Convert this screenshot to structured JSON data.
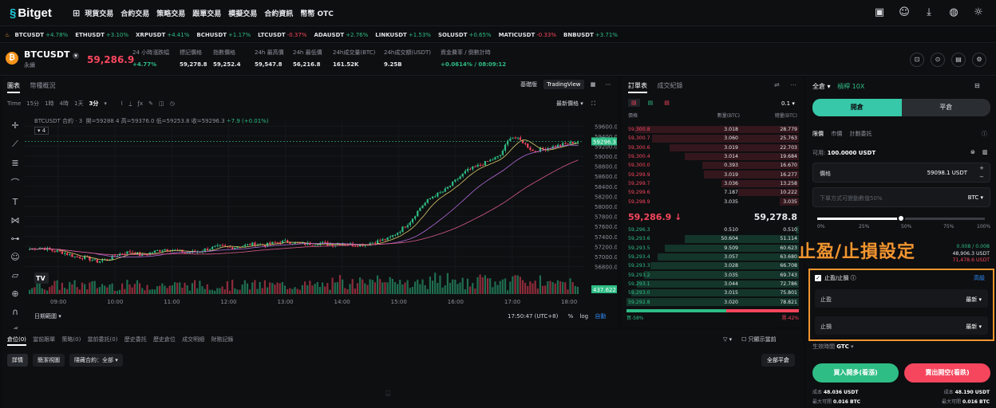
{
  "brand": {
    "name": "Bitget"
  },
  "nav": [
    "現貨交易",
    "合約交易",
    "策略交易",
    "跟單交易",
    "模擬交易",
    "合約資訊",
    "幣幣 OTC"
  ],
  "ticker": [
    {
      "sym": "BTCUSDT",
      "chg": "+4.78%",
      "dir": "up"
    },
    {
      "sym": "ETHUSDT",
      "chg": "+3.10%",
      "dir": "up"
    },
    {
      "sym": "XRPUSDT",
      "chg": "+4.41%",
      "dir": "up"
    },
    {
      "sym": "BCHUSDT",
      "chg": "+1.17%",
      "dir": "up"
    },
    {
      "sym": "LTCUSDT",
      "chg": "-0.37%",
      "dir": "dn"
    },
    {
      "sym": "ADAUSDT",
      "chg": "+2.76%",
      "dir": "up"
    },
    {
      "sym": "LINKUSDT",
      "chg": "+1.53%",
      "dir": "up"
    },
    {
      "sym": "SOLUSDT",
      "chg": "+0.65%",
      "dir": "up"
    },
    {
      "sym": "MATICUSDT",
      "chg": "-0.33%",
      "dir": "dn"
    },
    {
      "sym": "BNBUSDT",
      "chg": "+3.71%",
      "dir": "up"
    }
  ],
  "symbol": {
    "name": "BTCUSDT",
    "sub": "永續",
    "price": "59,286.9",
    "stats": [
      {
        "label": "24 小時漲跌幅",
        "value": "+4.77%",
        "cls": "up"
      },
      {
        "label": "標記價格",
        "value": "59,278.8",
        "cls": ""
      },
      {
        "label": "指數價格",
        "value": "59,252.4",
        "cls": ""
      },
      {
        "label": "24h 最高價",
        "value": "59,547.8",
        "cls": ""
      },
      {
        "label": "24h 最低價",
        "value": "56,216.8",
        "cls": ""
      },
      {
        "label": "24h成交量(BTC)",
        "value": "161.52K",
        "cls": ""
      },
      {
        "label": "24h成交額(USDT)",
        "value": "9.25B",
        "cls": ""
      },
      {
        "label": "資金費率 / 倒數計時",
        "value": "+0.0614% / 08:09:12",
        "cls": "up"
      }
    ]
  },
  "chart": {
    "tabs": [
      "圖表",
      "幣種概況"
    ],
    "views": [
      "基礎版",
      "TradingView"
    ],
    "timeframes": [
      "Time",
      "15分",
      "1時",
      "4時",
      "1天",
      "3分"
    ],
    "selected_tf": "3分",
    "latest_label": "最新價格",
    "ohlc_sym": "BTCUSDT 合約 · 3",
    "ohlc": "開=59288.4 高=59376.0 低=59253.8 收=59296.3",
    "ohlc_chg": "+7.9 (+0.01%)",
    "indicator": "4",
    "date_range": "日期範圍",
    "clock": "17:50:47 (UTC+8)",
    "pct": "%",
    "log": "log",
    "auto": "自動"
  },
  "chart_data": {
    "type": "candlestick",
    "x": [
      "09:00",
      "10:00",
      "11:00",
      "12:00",
      "13:00",
      "14:00",
      "15:00",
      "16:00",
      "17:00",
      "18:00"
    ],
    "y_ticks": [
      59600,
      59400,
      59200,
      59000,
      58800,
      58600,
      58400,
      58200,
      58000,
      57800,
      57600,
      57400,
      57200,
      57000,
      56800
    ],
    "ylim": [
      56650,
      59700
    ],
    "last_price": 59296.3,
    "volume_label": "437.622",
    "close_path": [
      57150,
      57180,
      57120,
      57080,
      57000,
      56980,
      56900,
      56950,
      57050,
      57100,
      57020,
      57090,
      57150,
      57120,
      57080,
      57100,
      57160,
      57200,
      57180,
      57210,
      57250,
      57230,
      57280,
      57300,
      57260,
      57250,
      57270,
      57240,
      57260,
      57230,
      57250,
      57300,
      57350,
      57500,
      57700,
      58000,
      58200,
      58300,
      58500,
      58700,
      58800,
      58900,
      59000,
      59400,
      59300,
      59100,
      59150,
      59200,
      59250,
      59296
    ]
  },
  "orderbook": {
    "tabs": [
      "訂單表",
      "成交紀錄"
    ],
    "precision": "0.1",
    "headers": [
      "價格",
      "數量(BTC)",
      "總量(BTC)"
    ],
    "asks": [
      [
        "59,300.8",
        "3.018",
        "28.779",
        0.95
      ],
      [
        "59,300.7",
        "3.060",
        "25.763",
        0.85
      ],
      [
        "59,300.6",
        "3.019",
        "22.703",
        0.75
      ],
      [
        "59,300.4",
        "3.014",
        "19.684",
        0.66
      ],
      [
        "59,300.0",
        "0.393",
        "16.670",
        0.56
      ],
      [
        "59,299.9",
        "3.019",
        "16.277",
        0.55
      ],
      [
        "59,299.7",
        "3.036",
        "13.258",
        0.45
      ],
      [
        "59,299.6",
        "7.187",
        "10.222",
        0.35
      ],
      [
        "59,298.9",
        "3.035",
        "3.035",
        0.11
      ]
    ],
    "mid_price": "59,286.9",
    "mid_arrow": "↓",
    "mark": "59,278.8",
    "bids": [
      [
        "59,296.3",
        "0.510",
        "0.510",
        0.02
      ],
      [
        "59,293.6",
        "50.604",
        "51.114",
        0.66
      ],
      [
        "59,293.5",
        "9.509",
        "60.623",
        0.78
      ],
      [
        "59,293.4",
        "3.057",
        "63.680",
        0.82
      ],
      [
        "59,293.3",
        "3.028",
        "66.708",
        0.86
      ],
      [
        "59,293.2",
        "3.035",
        "69.743",
        0.9
      ],
      [
        "59,293.1",
        "3.044",
        "72.786",
        0.94
      ],
      [
        "59,293.0",
        "3.015",
        "75.801",
        0.97
      ],
      [
        "59,292.8",
        "3.020",
        "78.821",
        1.0
      ]
    ],
    "buy_pct": "買-58%",
    "sell_pct": "賣-42%"
  },
  "trade": {
    "margin_mode": "全倉",
    "leverage": "槓桿 10X",
    "open": "開倉",
    "close": "平倉",
    "order_types": [
      "限價",
      "市價",
      "計劃委託"
    ],
    "avail_label": "可用:",
    "avail_value": "100.0000 USDT",
    "price_label": "價格",
    "price_value": "59098.1 USDT",
    "qty_placeholder": "下單方式可變動數值50%",
    "qty_unit": "BTC",
    "slider_ticks": [
      "0%",
      "25%",
      "50%",
      "75%",
      "100%"
    ],
    "slider_level": 0.5,
    "max_rows": [
      {
        "v": "0.008 / 0.008",
        "c": "#2ebd85"
      },
      {
        "v": "48,906.3 USDT",
        "c": "#e6e8eb"
      },
      {
        "v": "71,478.6 USDT",
        "c": "#f6465d"
      }
    ],
    "tpsl_title": "止盈/止損設定",
    "tpsl_label": "止盈/止損",
    "tpsl_adv": "高級",
    "tp_label": "止盈",
    "tp_value": "最新",
    "sl_label": "止損",
    "sl_value": "最新",
    "gtc_label": "生效時間",
    "gtc_value": "GTC",
    "buy": "買入開多(看漲)",
    "sell": "賣出開空(看跌)",
    "cost_label": "成本",
    "cost_buy": "48.036 USDT",
    "max_label": "最大可開",
    "max_buy": "0.016 BTC",
    "cost_sell": "48.190 USDT",
    "max_sell": "0.016 BTC"
  },
  "bottom": {
    "tabs": [
      "倉位(0)",
      "當前跟單",
      "策略(0)",
      "當前委託(0)",
      "歷史委託",
      "歷史倉位",
      "成交明細",
      "財務記錄"
    ],
    "chips": [
      "詳情",
      "簡潔視圖",
      "隱藏合約：全部"
    ],
    "only_current": "只顯示當前",
    "close_all": "全部平倉"
  },
  "colors": {
    "up": "#2ebd85",
    "down": "#f6465d",
    "accent": "#f2952f"
  }
}
